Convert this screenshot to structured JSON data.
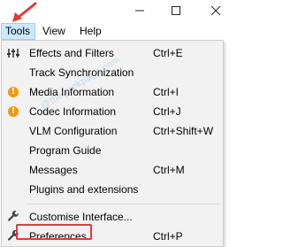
{
  "window": {
    "minimize_icon": "minimize-icon",
    "maximize_icon": "maximize-icon",
    "close_icon": "close-icon"
  },
  "menubar": {
    "items": [
      {
        "label": "Tools",
        "active": true
      },
      {
        "label": "View"
      },
      {
        "label": "Help"
      }
    ]
  },
  "tools_menu": {
    "items": [
      {
        "label": "Effects and Filters",
        "shortcut": "Ctrl+E",
        "icon": "sliders-icon"
      },
      {
        "label": "Track Synchronization",
        "shortcut": ""
      },
      {
        "label": "Media Information",
        "shortcut": "Ctrl+I",
        "icon": "info-warning-icon"
      },
      {
        "label": "Codec Information",
        "shortcut": "Ctrl+J",
        "icon": "info-warning-icon"
      },
      {
        "label": "VLM Configuration",
        "shortcut": "Ctrl+Shift+W"
      },
      {
        "label": "Program Guide",
        "shortcut": ""
      },
      {
        "label": "Messages",
        "shortcut": "Ctrl+M"
      },
      {
        "label": "Plugins and extensions",
        "shortcut": ""
      },
      {
        "label": "Customise Interface...",
        "shortcut": "",
        "icon": "wrench-icon"
      },
      {
        "label": "Preferences",
        "shortcut": "Ctrl+P",
        "icon": "wrench-icon",
        "highlighted": true
      }
    ]
  },
  "watermark": "@thegeekpage.com",
  "colors": {
    "menu_bg": "#f2f2f2",
    "active_menu_bg": "#cce8ff",
    "annotation_red": "#e03a3a",
    "warning_orange": "#f09a12"
  }
}
